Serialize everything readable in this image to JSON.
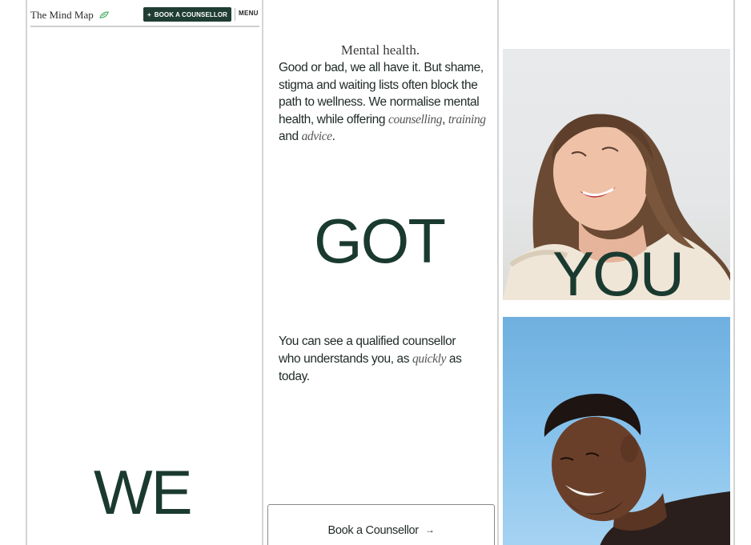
{
  "header": {
    "logo_text": "The Mind Map",
    "book_button_label": "BOOK A COUNSELLOR",
    "menu_label": "MENU"
  },
  "hero_words": {
    "we": "WE",
    "got": "GOT",
    "you": "YOU"
  },
  "intro": {
    "title": "Mental health.",
    "body_part1": "Good or bad, we all have it. But shame, stigma and waiting lists often block the path to wellness. We normalise mental health, while offering ",
    "link_counselling": "counselling",
    "sep1": ", ",
    "link_training": "training",
    "sep2": " and ",
    "link_advice": "advice",
    "end": "."
  },
  "counsellor_text": {
    "part1": "You can see a qualified counsellor who understands you, as ",
    "quickly": "quickly",
    "part2": " as today."
  },
  "cta": {
    "label": "Book a Counsellor",
    "arrow": "→"
  },
  "colors": {
    "brand_green": "#1f3d33",
    "headline_green": "#1a3a30"
  }
}
